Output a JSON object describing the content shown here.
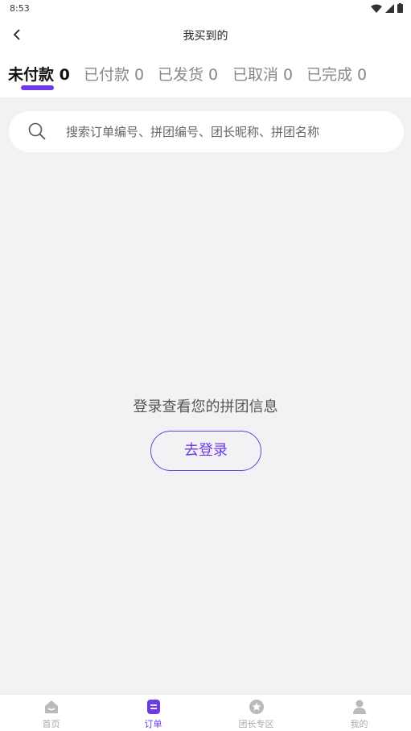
{
  "status_bar": {
    "time": "8:53"
  },
  "header": {
    "title": "我买到的"
  },
  "tabs": [
    {
      "label": "未付款 0",
      "active": true
    },
    {
      "label": "已付款 0",
      "active": false
    },
    {
      "label": "已发货 0",
      "active": false
    },
    {
      "label": "已取消 0",
      "active": false
    },
    {
      "label": "已完成 0",
      "active": false
    }
  ],
  "search": {
    "placeholder": "搜索订单编号、拼团编号、团长昵称、拼团名称"
  },
  "empty_state": {
    "message": "登录查看您的拼团信息",
    "login_button": "去登录"
  },
  "bottom_nav": [
    {
      "label": "首页",
      "icon": "home-icon",
      "active": false
    },
    {
      "label": "订单",
      "icon": "order-icon",
      "active": true
    },
    {
      "label": "团长专区",
      "icon": "star-badge-icon",
      "active": false
    },
    {
      "label": "我的",
      "icon": "user-icon",
      "active": false
    }
  ],
  "colors": {
    "accent": "#6b3be6",
    "background": "#f2f2f5",
    "inactive": "#aaaaaa"
  }
}
